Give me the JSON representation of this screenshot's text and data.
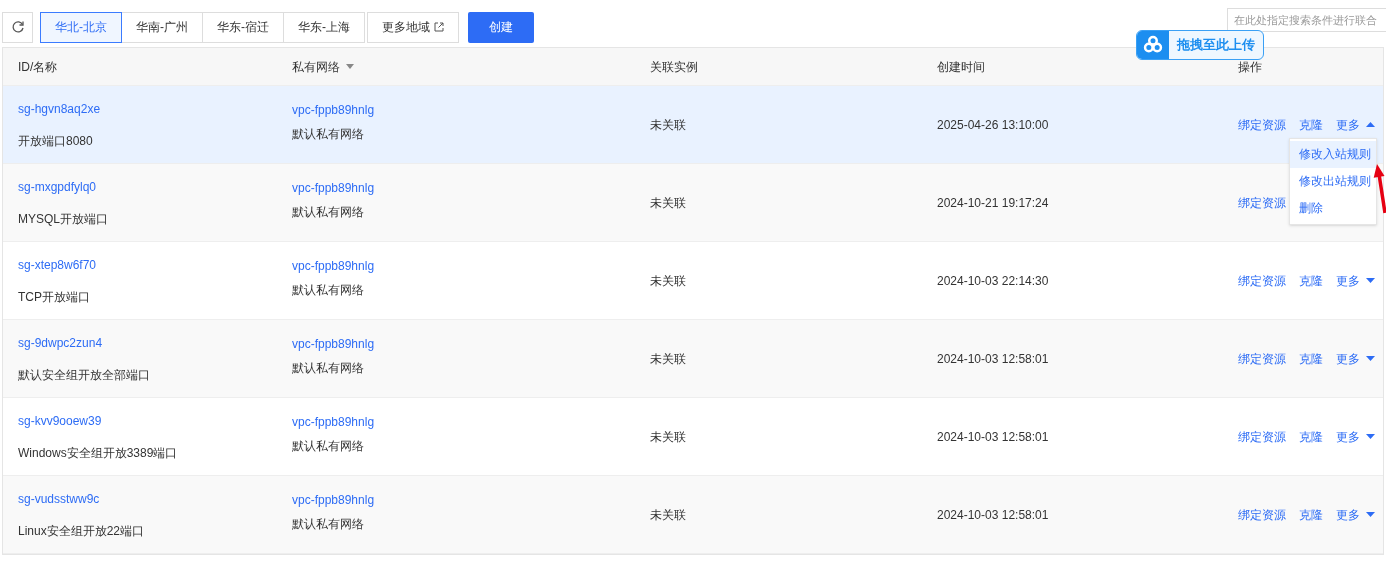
{
  "toolbar": {
    "regions": [
      {
        "label": "华北-北京",
        "selected": true
      },
      {
        "label": "华南-广州",
        "selected": false
      },
      {
        "label": "华东-宿迁",
        "selected": false
      },
      {
        "label": "华东-上海",
        "selected": false
      }
    ],
    "more_regions": "更多地域",
    "create_button": "创建",
    "search": {
      "placeholder": "在此处指定搜索条件进行联合"
    }
  },
  "upload_badge": "拖拽至此上传",
  "table": {
    "columns": [
      "ID/名称",
      "私有网络",
      "关联实例",
      "创建时间",
      "操作"
    ],
    "rows": [
      {
        "id": "sg-hgvn8aq2xe",
        "name": "开放端口8080",
        "vpc": "vpc-fppb89hnlg",
        "vpc_name": "默认私有网络",
        "instance": "未关联",
        "created": "2025-04-26 13:10:00",
        "actions": [
          "绑定资源",
          "克隆"
        ],
        "more": "更多",
        "selected": true,
        "expanded": true
      },
      {
        "id": "sg-mxgpdfylq0",
        "name": "MYSQL开放端口",
        "vpc": "vpc-fppb89hnlg",
        "vpc_name": "默认私有网络",
        "instance": "未关联",
        "created": "2024-10-21 19:17:24",
        "actions": [
          "绑定资源"
        ],
        "selected": false
      },
      {
        "id": "sg-xtep8w6f70",
        "name": "TCP开放端口",
        "vpc": "vpc-fppb89hnlg",
        "vpc_name": "默认私有网络",
        "instance": "未关联",
        "created": "2024-10-03 22:14:30",
        "actions": [
          "绑定资源",
          "克隆"
        ],
        "more": "更多",
        "selected": false,
        "expanded": false
      },
      {
        "id": "sg-9dwpc2zun4",
        "name": "默认安全组开放全部端口",
        "vpc": "vpc-fppb89hnlg",
        "vpc_name": "默认私有网络",
        "instance": "未关联",
        "created": "2024-10-03 12:58:01",
        "actions": [
          "绑定资源",
          "克隆"
        ],
        "more": "更多",
        "selected": false,
        "expanded": false
      },
      {
        "id": "sg-kvv9ooew39",
        "name": "Windows安全组开放3389端口",
        "vpc": "vpc-fppb89hnlg",
        "vpc_name": "默认私有网络",
        "instance": "未关联",
        "created": "2024-10-03 12:58:01",
        "actions": [
          "绑定资源",
          "克隆"
        ],
        "more": "更多",
        "selected": false,
        "expanded": false
      },
      {
        "id": "sg-vudsstww9c",
        "name": "Linux安全组开放22端口",
        "vpc": "vpc-fppb89hnlg",
        "vpc_name": "默认私有网络",
        "instance": "未关联",
        "created": "2024-10-03 12:58:01",
        "actions": [
          "绑定资源",
          "克隆"
        ],
        "more": "更多",
        "selected": false,
        "expanded": false
      }
    ]
  },
  "dropdown_menu": [
    {
      "label": "修改入站规则",
      "selected": true
    },
    {
      "label": "修改出站规则",
      "selected": false
    },
    {
      "label": "删除",
      "selected": false
    }
  ]
}
